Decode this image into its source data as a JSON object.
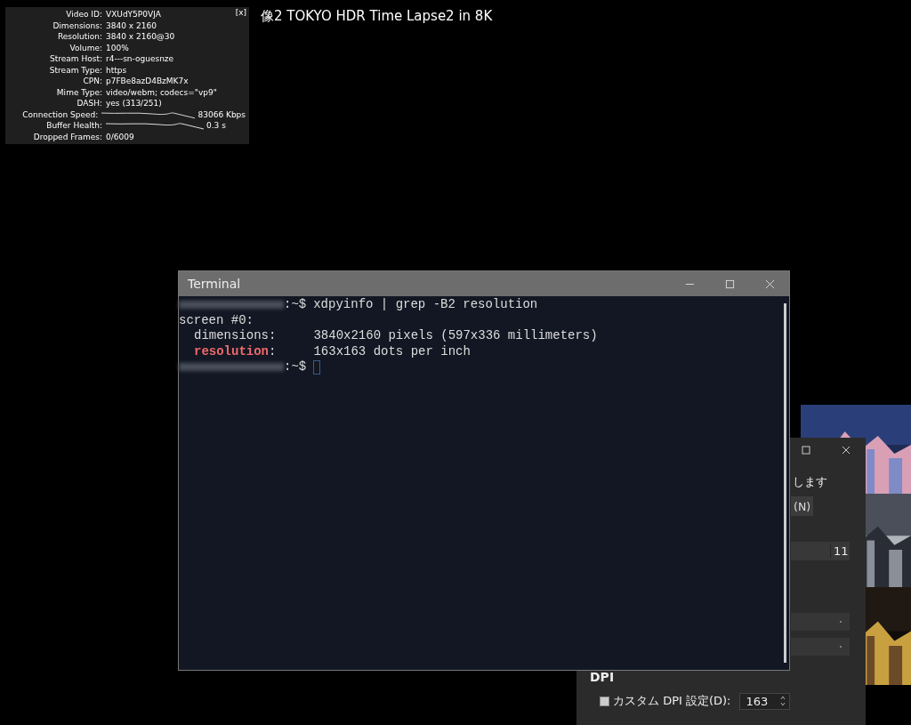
{
  "video_title": "像2 TOKYO HDR Time Lapse2 in 8K",
  "stats": {
    "close": "[x]",
    "rows": [
      {
        "kind": "text",
        "label": "Video ID:",
        "value": "VXUdY5P0VJA"
      },
      {
        "kind": "text",
        "label": "Dimensions:",
        "value": "3840 x 2160"
      },
      {
        "kind": "text",
        "label": "Resolution:",
        "value": "3840 x 2160@30"
      },
      {
        "kind": "text",
        "label": "Volume:",
        "value": "100%"
      },
      {
        "kind": "text",
        "label": "Stream Host:",
        "value": "r4---sn-oguesnze"
      },
      {
        "kind": "text",
        "label": "Stream Type:",
        "value": "https"
      },
      {
        "kind": "text",
        "label": "CPN:",
        "value": "p7FBe8azD4BzMK7x"
      },
      {
        "kind": "text",
        "label": "Mime Type:",
        "value": "video/webm; codecs=\"vp9\""
      },
      {
        "kind": "text",
        "label": "DASH:",
        "value": "yes (313/251)"
      },
      {
        "kind": "graph",
        "label": "Connection Speed:",
        "value": "83066 Kbps"
      },
      {
        "kind": "graph",
        "label": "Buffer Health:",
        "value": "0.3 s"
      },
      {
        "kind": "text",
        "label": "Dropped Frames:",
        "value": "0/6009"
      }
    ]
  },
  "settings_window": {
    "subtitle": "します",
    "tabs": [
      {
        "label": "(N)",
        "selected": true
      }
    ],
    "font_size": "11",
    "dpi_label": "DPI",
    "custom_dpi": {
      "label": "カスタム DPI 設定(D):",
      "checked": true,
      "value": "163"
    }
  },
  "terminal": {
    "title": "Terminal",
    "lines": [
      {
        "kind": "prompt",
        "prompt": ":~$",
        "command": "xdpyinfo | grep -B2 resolution"
      },
      {
        "kind": "output",
        "text": "screen #0:"
      },
      {
        "kind": "field",
        "key": "dimensions",
        "colon": ":",
        "value": "3840x2160 pixels (597x336 millimeters)",
        "highlighted": false
      },
      {
        "kind": "field",
        "key": "resolution",
        "colon": ":",
        "value": "163x163 dots per inch",
        "highlighted": true
      },
      {
        "kind": "prompt",
        "prompt": ":~$",
        "cursor": true
      }
    ]
  }
}
